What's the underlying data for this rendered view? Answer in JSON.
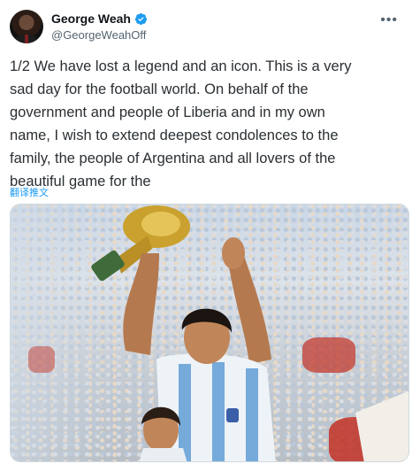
{
  "user": {
    "display_name": "George Weah",
    "handle": "@GeorgeWeahOff",
    "verified": true
  },
  "tweet": {
    "text": "1/2 We have lost a legend and an icon. This is a very\nsad day for the football world. On behalf of the\ngovernment and people of Liberia and in my own\nname, I wish to extend deepest condolences to the\nfamily, the people of Argentina and all lovers of the\nbeautiful game for the",
    "translate_label": "翻译推文"
  },
  "media": {
    "alt": "Photo of a footballer holding up the World Cup trophy"
  },
  "icons": {
    "verified": "verified-badge-icon",
    "more": "more-icon"
  },
  "colors": {
    "accent": "#1d9bf0",
    "text": "#0f1419",
    "muted": "#536471",
    "argentina_blue": "#75aadb"
  }
}
